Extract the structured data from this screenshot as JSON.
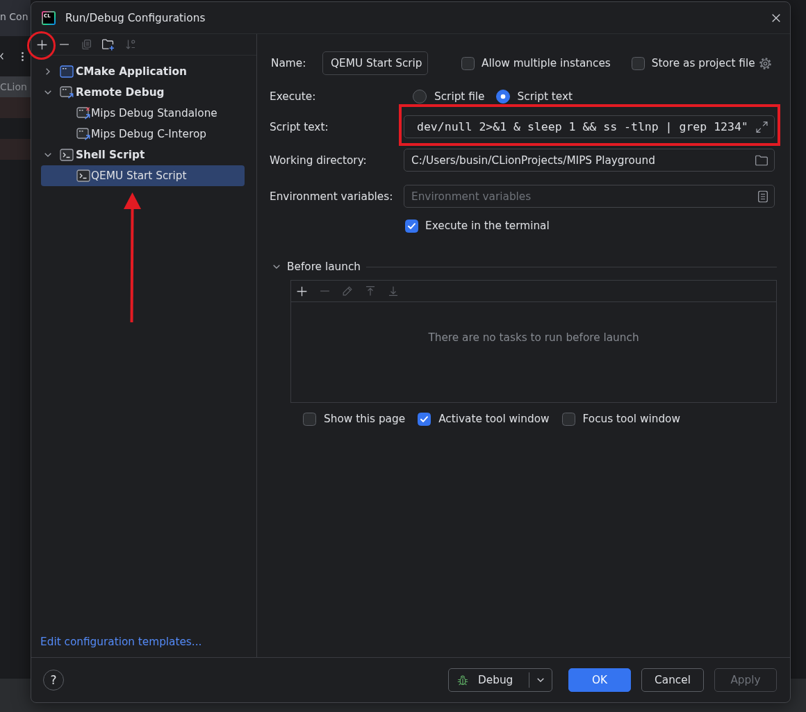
{
  "background": {
    "header_text": "n Con",
    "project_label": "CLion"
  },
  "window": {
    "logo_text": "CL",
    "title": "Run/Debug Configurations"
  },
  "sidebar": {
    "toolbar": [
      {
        "kind": "add",
        "disabled": false
      },
      {
        "kind": "remove",
        "disabled": false
      },
      {
        "kind": "copy",
        "disabled": true
      },
      {
        "kind": "new-folder",
        "disabled": false
      },
      {
        "kind": "sort",
        "disabled": true
      }
    ],
    "tree": [
      {
        "label": "CMake Application",
        "kind": "cmake",
        "expanded": false,
        "selected": false
      },
      {
        "label": "Remote Debug",
        "kind": "remote",
        "expanded": true,
        "selected": false,
        "children": [
          {
            "label": "Mips Debug Standalone",
            "kind": "remote-error",
            "selected": false
          },
          {
            "label": "Mips Debug C-Interop",
            "kind": "remote",
            "selected": false
          }
        ]
      },
      {
        "label": "Shell Script",
        "kind": "shell",
        "expanded": true,
        "selected": false,
        "children": [
          {
            "label": "QEMU Start Script",
            "kind": "shell",
            "selected": true
          }
        ]
      }
    ],
    "templates_link": "Edit configuration templates..."
  },
  "form": {
    "name": {
      "label": "Name:",
      "value": "QEMU Start Scrip"
    },
    "flags": [
      {
        "label": "Allow multiple instances",
        "kind": "plain",
        "checked": false
      },
      {
        "label": "Store as project file",
        "kind": "settings",
        "checked": false
      }
    ],
    "execute": {
      "label": "Execute:",
      "options": [
        {
          "label": "Script file",
          "selected": false
        },
        {
          "label": "Script text",
          "selected": true
        }
      ]
    },
    "fields": [
      {
        "label": "Script text:",
        "kind": "code",
        "value": "dev/null 2>&1 & sleep 1 && ss -tlnp | grep 1234\""
      },
      {
        "label": "Working directory:",
        "kind": "folder",
        "value": "C:/Users/busin/CLionProjects/MIPS Playground"
      },
      {
        "label": "Environment variables:",
        "kind": "list",
        "placeholder": "Environment variables"
      }
    ],
    "terminal": {
      "label": "Execute in the terminal",
      "checked": true
    }
  },
  "before_launch": {
    "title": "Before launch",
    "expanded": true,
    "toolbar": [
      {
        "kind": "add",
        "disabled": false
      },
      {
        "kind": "remove",
        "disabled": true
      },
      {
        "kind": "edit",
        "disabled": true
      },
      {
        "kind": "move-up",
        "disabled": true
      },
      {
        "kind": "move-down",
        "disabled": true
      }
    ],
    "empty_text": "There are no tasks to run before launch",
    "options": [
      {
        "label": "Show this page",
        "checked": false
      },
      {
        "label": "Activate tool window",
        "checked": true
      },
      {
        "label": "Focus tool window",
        "checked": false
      }
    ]
  },
  "footer": {
    "help": "?",
    "run_button": {
      "label": "Debug"
    },
    "buttons": [
      {
        "label": "OK",
        "kind": "primary",
        "disabled": false
      },
      {
        "label": "Cancel",
        "kind": "secondary",
        "disabled": false
      },
      {
        "label": "Apply",
        "kind": "secondary",
        "disabled": true
      }
    ]
  },
  "annotations": [
    {
      "kind": "circle"
    },
    {
      "kind": "rectangle"
    },
    {
      "kind": "arrow"
    }
  ]
}
